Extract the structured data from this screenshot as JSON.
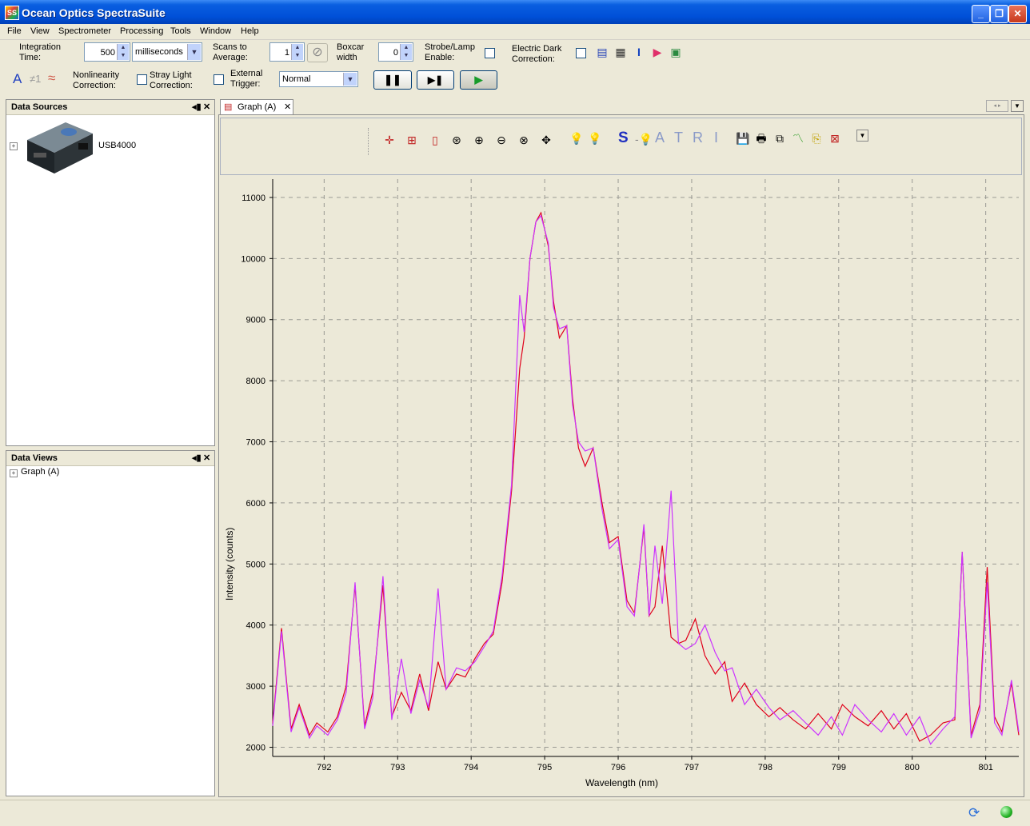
{
  "window": {
    "title": "Ocean Optics SpectraSuite",
    "app_icon": "SS"
  },
  "menu": [
    "File",
    "View",
    "Spectrometer",
    "Processing",
    "Tools",
    "Window",
    "Help"
  ],
  "toolbar": {
    "integration_time_label": "Integration\nTime:",
    "integration_time_value": "500",
    "integration_unit": "milliseconds",
    "scans_label": "Scans to\nAverage:",
    "scans_value": "1",
    "boxcar_label": "Boxcar\nwidth",
    "boxcar_value": "0",
    "strobe_label": "Strobe/Lamp\nEnable:",
    "dark_label": "Electric Dark\nCorrection:",
    "nonlinearity_label": "Nonlinearity\nCorrection:",
    "stray_label": "Stray Light\nCorrection:",
    "trigger_label": "External\nTrigger:",
    "trigger_value": "Normal",
    "a_glyph": "A",
    "ne1_glyph": "≠1",
    "tilde_glyph": "≈"
  },
  "data_sources": {
    "title": "Data Sources",
    "device": "USB4000"
  },
  "data_views": {
    "title": "Data Views",
    "item": "Graph (A)"
  },
  "graph_tab": {
    "label": "Graph (A)"
  },
  "graph_toolbar": {
    "letters": [
      "S",
      "A",
      "T",
      "R",
      "I"
    ]
  },
  "colors": {
    "series1": "#e0001a",
    "series2": "#cc33ff",
    "titlebar": "#0050d8"
  },
  "chart_data": {
    "type": "line",
    "xlabel": "Wavelength (nm)",
    "ylabel": "Intensity (counts)",
    "xlim": [
      791.3,
      801.45
    ],
    "ylim": [
      1850,
      11300
    ],
    "x_ticks": [
      792,
      793,
      794,
      795,
      796,
      797,
      798,
      799,
      800,
      801
    ],
    "y_ticks": [
      2000,
      3000,
      4000,
      5000,
      6000,
      7000,
      8000,
      9000,
      10000,
      11000
    ],
    "grid": true,
    "series": [
      {
        "color": "#e0001a",
        "x": [
          791.3,
          791.42,
          791.55,
          791.66,
          791.8,
          791.9,
          792.05,
          792.18,
          792.3,
          792.42,
          792.55,
          792.66,
          792.8,
          792.92,
          793.05,
          793.18,
          793.3,
          793.42,
          793.55,
          793.66,
          793.8,
          793.92,
          794.05,
          794.18,
          794.3,
          794.42,
          794.55,
          794.66,
          794.72,
          794.8,
          794.88,
          794.95,
          795.05,
          795.12,
          795.2,
          795.3,
          795.38,
          795.46,
          795.55,
          795.66,
          795.78,
          795.88,
          796.0,
          796.12,
          796.22,
          796.35,
          796.42,
          796.5,
          796.6,
          796.72,
          796.82,
          796.92,
          797.05,
          797.18,
          797.32,
          797.45,
          797.55,
          797.72,
          797.88,
          798.05,
          798.2,
          798.38,
          798.55,
          798.72,
          798.9,
          799.05,
          799.22,
          799.4,
          799.58,
          799.75,
          799.92,
          800.1,
          800.25,
          800.42,
          800.58,
          800.68,
          800.8,
          800.92,
          801.02,
          801.12,
          801.22,
          801.35,
          801.45
        ],
        "y": [
          2400,
          3950,
          2300,
          2700,
          2200,
          2400,
          2250,
          2500,
          3000,
          4650,
          2350,
          2900,
          4650,
          2500,
          2900,
          2600,
          3200,
          2600,
          3400,
          2950,
          3200,
          3150,
          3450,
          3700,
          3850,
          4700,
          6200,
          8200,
          8700,
          10000,
          10600,
          10750,
          10200,
          9300,
          8700,
          8900,
          7700,
          6900,
          6600,
          6900,
          6000,
          5350,
          5450,
          4400,
          4200,
          5600,
          4150,
          4300,
          5300,
          3800,
          3700,
          3750,
          4100,
          3500,
          3200,
          3400,
          2750,
          3050,
          2700,
          2500,
          2650,
          2450,
          2300,
          2550,
          2300,
          2700,
          2500,
          2350,
          2600,
          2300,
          2550,
          2100,
          2200,
          2400,
          2450,
          5200,
          2200,
          2700,
          4950,
          2500,
          2250,
          3050,
          2200
        ]
      },
      {
        "color": "#cc33ff",
        "x": [
          791.3,
          791.42,
          791.55,
          791.66,
          791.8,
          791.9,
          792.05,
          792.18,
          792.3,
          792.42,
          792.55,
          792.66,
          792.8,
          792.92,
          793.05,
          793.18,
          793.3,
          793.42,
          793.55,
          793.66,
          793.8,
          793.92,
          794.05,
          794.18,
          794.3,
          794.42,
          794.55,
          794.66,
          794.72,
          794.8,
          794.88,
          794.95,
          795.05,
          795.12,
          795.2,
          795.3,
          795.38,
          795.46,
          795.55,
          795.66,
          795.78,
          795.88,
          796.0,
          796.12,
          796.22,
          796.35,
          796.42,
          796.5,
          796.6,
          796.72,
          796.82,
          796.92,
          797.05,
          797.18,
          797.32,
          797.45,
          797.55,
          797.72,
          797.88,
          798.05,
          798.2,
          798.38,
          798.55,
          798.72,
          798.9,
          799.05,
          799.22,
          799.4,
          799.58,
          799.75,
          799.92,
          800.1,
          800.25,
          800.42,
          800.58,
          800.68,
          800.8,
          800.92,
          801.02,
          801.12,
          801.22,
          801.35,
          801.45
        ],
        "y": [
          2350,
          3900,
          2250,
          2650,
          2150,
          2350,
          2200,
          2450,
          2900,
          4700,
          2300,
          2800,
          4800,
          2450,
          3450,
          2550,
          3100,
          2650,
          4600,
          2950,
          3300,
          3250,
          3400,
          3650,
          3900,
          4800,
          6300,
          9400,
          8800,
          10000,
          10600,
          10700,
          10250,
          9200,
          8850,
          8900,
          7600,
          7000,
          6850,
          6900,
          5900,
          5250,
          5400,
          4300,
          4150,
          5650,
          4150,
          5300,
          4350,
          6200,
          3700,
          3600,
          3700,
          4000,
          3550,
          3250,
          3300,
          2700,
          2950,
          2650,
          2450,
          2600,
          2400,
          2200,
          2500,
          2200,
          2700,
          2450,
          2250,
          2550,
          2200,
          2500,
          2050,
          2300,
          2500,
          5200,
          2150,
          2600,
          4700,
          2400,
          2200,
          3100,
          2250
        ]
      }
    ]
  }
}
